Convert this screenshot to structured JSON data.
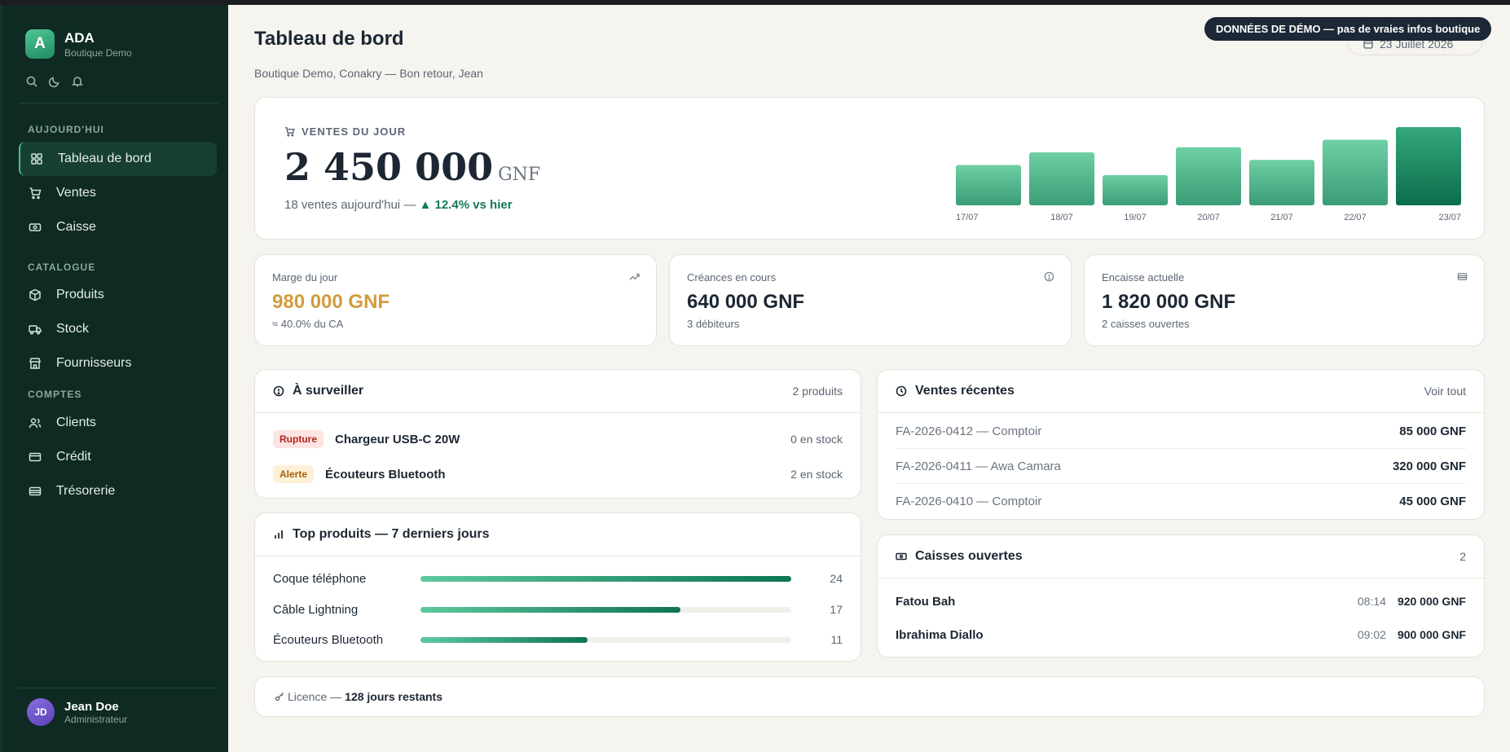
{
  "brand": {
    "initial": "A",
    "name": "ADA",
    "subtitle": "Boutique Demo"
  },
  "sidebar": {
    "tools": [
      "search-icon",
      "moon-icon",
      "bell-icon"
    ],
    "sections": [
      {
        "title": "AUJOURD'HUI",
        "items": [
          {
            "label": "Tableau de bord",
            "icon": "grid-icon",
            "active": true
          },
          {
            "label": "Ventes",
            "icon": "cart-icon"
          },
          {
            "label": "Caisse",
            "icon": "cash-icon"
          }
        ]
      },
      {
        "title": "CATALOGUE",
        "items": [
          {
            "label": "Produits",
            "icon": "box-icon"
          },
          {
            "label": "Stock",
            "icon": "truck-icon"
          },
          {
            "label": "Fournisseurs",
            "icon": "store-icon"
          }
        ]
      },
      {
        "title": "COMPTES",
        "items": [
          {
            "label": "Clients",
            "icon": "users-icon"
          },
          {
            "label": "Crédit",
            "icon": "card-icon"
          },
          {
            "label": "Trésorerie",
            "icon": "wallet-icon"
          }
        ]
      }
    ],
    "user": {
      "initials": "JD",
      "name": "Jean Doe",
      "role": "Administrateur"
    }
  },
  "header": {
    "title": "Tableau de bord",
    "subtitle": "Boutique Demo, Conakry — Bon retour, Jean",
    "date": "23 Juillet 2026",
    "demo_banner": "DONNÉES DE DÉMO — pas de vraies infos boutique"
  },
  "hero": {
    "label": "VENTES DU JOUR",
    "amount": "2 450 000",
    "unit": "GNF",
    "sales_count": "18 ventes aujourd'hui —",
    "trend": "▲ 12.4% vs hier"
  },
  "chart_data": {
    "type": "bar",
    "categories": [
      "17/07",
      "18/07",
      "19/07",
      "20/07",
      "21/07",
      "22/07",
      "23/07"
    ],
    "values": [
      1.6,
      2.1,
      1.2,
      2.3,
      1.8,
      2.6,
      3.1
    ],
    "title": "",
    "xlabel": "",
    "ylabel": "",
    "colors": {
      "bar_top": "#6fcfa5",
      "bar_bottom": "#3a9d76",
      "last_bar_top": "#35a87b",
      "last_bar_bottom": "#0b6d4b"
    }
  },
  "kpis": [
    {
      "label": "Marge du jour",
      "value": "980 000 GNF",
      "sub": "≈ 40.0% du CA",
      "icon": "trending-up-icon",
      "accent": "#d39b3d"
    },
    {
      "label": "Créances en cours",
      "value": "640 000 GNF",
      "sub": "3 débiteurs",
      "icon": "alert-circle-icon"
    },
    {
      "label": "Encaisse actuelle",
      "value": "1 820 000 GNF",
      "sub": "2 caisses ouvertes",
      "icon": "wallet-icon"
    }
  ],
  "watch": {
    "title": "À surveiller",
    "meta": "2 produits",
    "rows": [
      {
        "badge": "Rupture",
        "name": "Chargeur USB-C 20W",
        "stock": "0 en stock"
      },
      {
        "badge": "Alerte",
        "name": "Écouteurs Bluetooth",
        "stock": "2 en stock"
      }
    ]
  },
  "top": {
    "title": "Top produits — 7 derniers jours",
    "rows": [
      {
        "name": "Coque téléphone",
        "count": "24",
        "ratio": 1.0
      },
      {
        "name": "Câble Lightning",
        "count": "17",
        "ratio": 0.7
      },
      {
        "name": "Écouteurs Bluetooth",
        "count": "11",
        "ratio": 0.45
      }
    ]
  },
  "recent": {
    "title": "Ventes récentes",
    "link": "Voir tout",
    "rows": [
      {
        "label": "FA-2026-0412 — Comptoir",
        "amount": "85 000 GNF"
      },
      {
        "label": "FA-2026-0411 — Awa Camara",
        "amount": "320 000 GNF"
      },
      {
        "label": "FA-2026-0410 — Comptoir",
        "amount": "45 000 GNF"
      }
    ]
  },
  "caisses": {
    "title": "Caisses ouvertes",
    "count": "2",
    "rows": [
      {
        "name": "Fatou Bah",
        "time": "08:14",
        "amount": "920 000 GNF"
      },
      {
        "name": "Ibrahima Diallo",
        "time": "09:02",
        "amount": "900 000 GNF"
      }
    ]
  },
  "licence": {
    "prefix": "Licence —",
    "days": "128 jours restants"
  }
}
